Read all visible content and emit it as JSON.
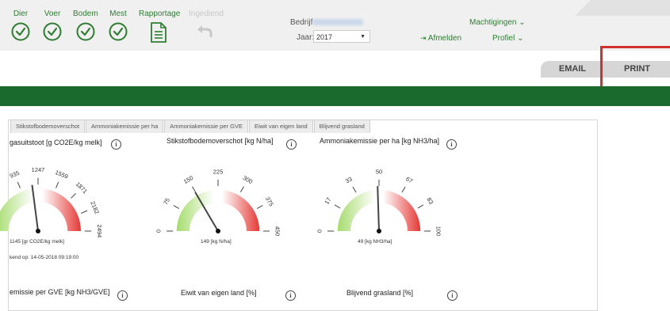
{
  "nav": [
    {
      "label": "Dier",
      "enabled": true,
      "icon": "check-circle-icon"
    },
    {
      "label": "Voer",
      "enabled": true,
      "icon": "check-circle-icon"
    },
    {
      "label": "Bodem",
      "enabled": true,
      "icon": "check-circle-icon"
    },
    {
      "label": "Mest",
      "enabled": true,
      "icon": "check-circle-icon"
    },
    {
      "label": "Rapportage",
      "enabled": true,
      "icon": "document-icon"
    },
    {
      "label": "Ingediend",
      "enabled": false,
      "icon": "undo-arrow-icon"
    }
  ],
  "header": {
    "bedrijf_label": "Bedrijf",
    "jaar_label": "Jaar:",
    "jaar_value": "2017",
    "afmelden_label": "Afmelden",
    "machtigingen_label": "Machtigingen ⌄",
    "profiel_label": "Profiel ⌄"
  },
  "actions": {
    "email_label": "EMAIL",
    "print_label": "PRINT"
  },
  "colors": {
    "brand_green": "#1b6a2d",
    "nav_green": "#2e7d32",
    "highlight_red": "#d32f2f"
  },
  "tabs": [
    "Stikstofbodemoverschot",
    "Ammoniakemissie per ha",
    "Ammoniakemissie per GVE",
    "Eiwit van eigen land",
    "Blijvend grasland"
  ],
  "gauges": [
    {
      "title": "gasuitstoot [g CO2E/kg melk]",
      "value_text": "1145 [gr CO2E/kg melk]",
      "ticks": [
        "935",
        "1247",
        "1559",
        "1871",
        "2182",
        "2494"
      ],
      "min": 0,
      "max": 2494,
      "value": 1145
    },
    {
      "title": "Stikstofbodemoverschot [kg N/ha]",
      "value_text": "149 [kg N/ha]",
      "ticks": [
        "0",
        "75",
        "150",
        "225",
        "300",
        "375",
        "450"
      ],
      "min": 0,
      "max": 450,
      "value": 149
    },
    {
      "title": "Ammoniakemissie per ha [kg NH3/ha]",
      "value_text": "49 [kg NH3/ha]",
      "ticks": [
        "0",
        "17",
        "33",
        "50",
        "67",
        "83",
        "100"
      ],
      "min": 0,
      "max": 100,
      "value": 49
    }
  ],
  "updated_text": "kend op: 14-05-2018 09:19:00",
  "row2_titles": [
    "emissie per GVE [kg NH3/GVE]",
    "Eiwit van eigen land [%]",
    "Blijvend grasland [%]"
  ],
  "info_glyph": "i"
}
